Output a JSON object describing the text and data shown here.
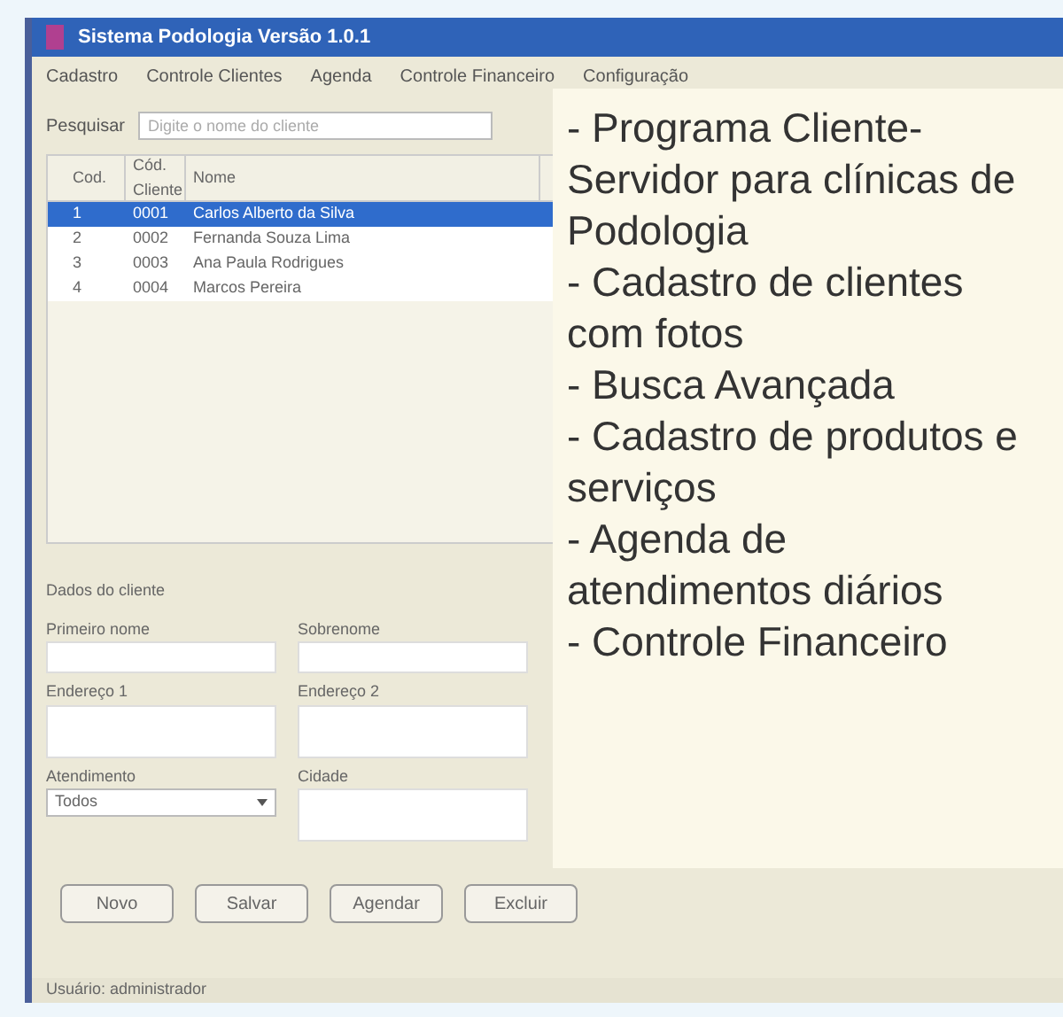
{
  "window": {
    "title": "Sistema Podologia Versão 1.0.1"
  },
  "menu": [
    "Cadastro",
    "Controle Clientes",
    "Agenda",
    "Controle Financeiro",
    "Configuração"
  ],
  "search": {
    "label": "Pesquisar",
    "placeholder": "Digite o nome do cliente"
  },
  "table": {
    "columns": [
      "Cod.",
      "Cód. Cliente",
      "Nome"
    ],
    "rows": [
      {
        "cells": [
          "1",
          "0001",
          "Carlos Alberto da Silva"
        ],
        "selected": true
      },
      {
        "cells": [
          "2",
          "0002",
          "Fernanda Souza Lima"
        ],
        "selected": false
      },
      {
        "cells": [
          "3",
          "0003",
          "Ana Paula Rodrigues"
        ],
        "selected": false
      },
      {
        "cells": [
          "4",
          "0004",
          "Marcos Pereira"
        ],
        "selected": false
      }
    ]
  },
  "details": {
    "title": "Dados do cliente",
    "fields": [
      {
        "label": "Primeiro nome",
        "kind": "input"
      },
      {
        "label": "Sobrenome",
        "kind": "input"
      },
      {
        "label": "Endereço 1",
        "kind": "input"
      },
      {
        "label": "Endereço 2",
        "kind": "input"
      },
      {
        "label": "Atendimento",
        "value": "Todos",
        "kind": "select"
      },
      {
        "label": "Cidade",
        "kind": "input"
      }
    ]
  },
  "buttons": [
    "Novo",
    "Salvar",
    "Agendar",
    "Excluir"
  ],
  "status_bar": "Usuário: administrador",
  "overlay": [
    "- Programa Cliente-Servidor para clínicas de Podologia",
    "- Cadastro de clientes com fotos",
    "- Busca Avançada",
    "- Cadastro de produtos e serviços",
    "- Agenda de atendimentos diários",
    "- Controle Financeiro"
  ]
}
